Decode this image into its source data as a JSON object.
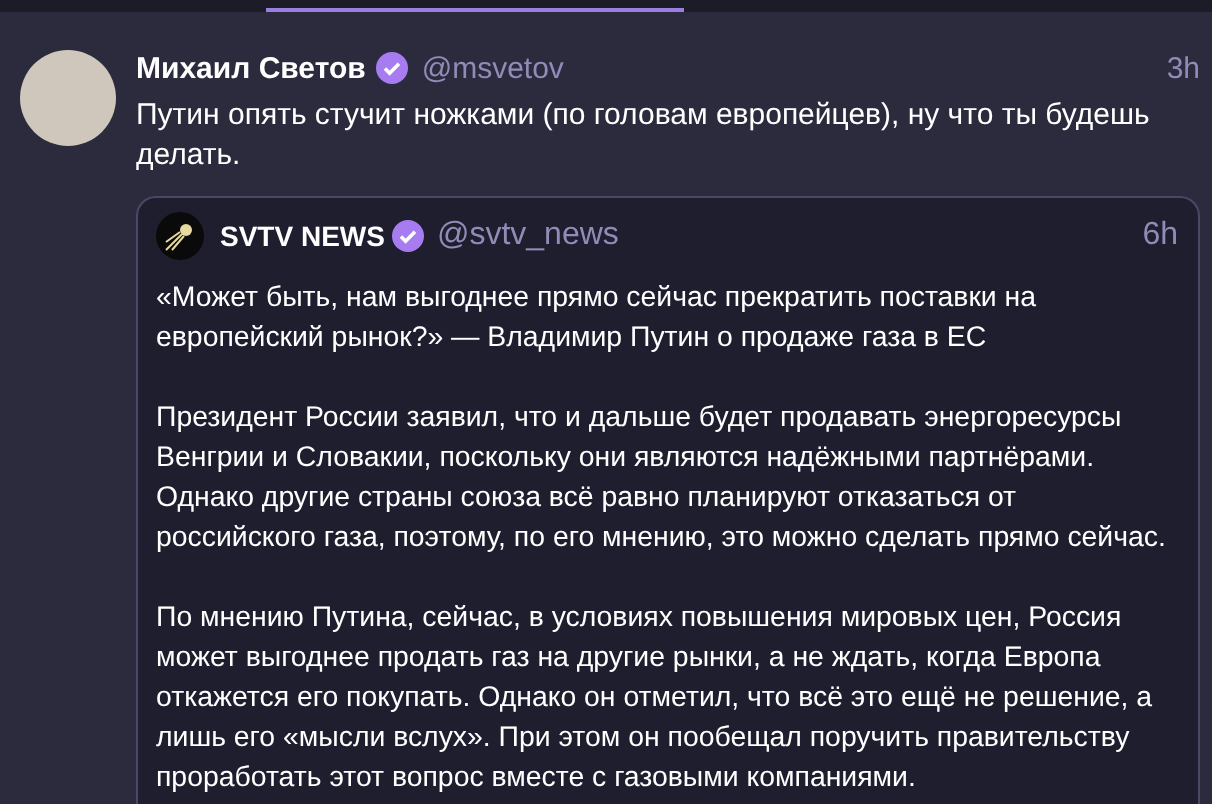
{
  "tweet": {
    "author": {
      "name": "Михаил Светов",
      "verified": true,
      "handle": "@msvetov"
    },
    "time": "3h",
    "text": "Путин опять стучит ножками (по головам европейцев), ну что ты будешь делать.",
    "quote": {
      "author": {
        "name": "SVTV NEWS",
        "verified": true,
        "handle": "@svtv_news"
      },
      "time": "6h",
      "paragraphs": [
        "«Может быть, нам выгоднее прямо сейчас прекратить поставки на европейский рынок?» — Владимир Путин о продаже газа в ЕС",
        "Президент России заявил, что и дальше будет продавать энергоресурсы Венгрии и Словакии, поскольку они являются надёжными партнёрами. Однако другие страны союза всё равно планируют отказаться от российского газа, поэтому, по его мнению, это можно сделать прямо сейчас.",
        "По мнению Путина, сейчас, в условиях повышения мировых цен, Россия может выгоднее продать газ на другие рынки, а не ждать, когда Европа откажется его покупать. Однако он отметил, что всё это ещё не решение, а лишь его «мысли вслух». При этом он пообещал поручить правительству проработать этот вопрос вместе с газовыми компаниями."
      ]
    }
  }
}
